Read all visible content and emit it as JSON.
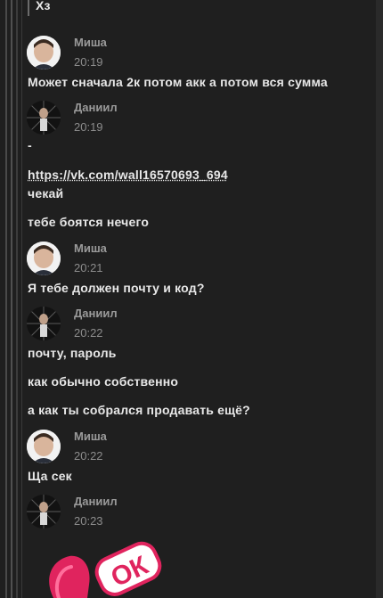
{
  "messages": {
    "quoted": "Хз",
    "m1": {
      "author": "Миша",
      "time": "20:19",
      "lines": [
        "Может сначала 2к потом акк а потом вся сумма"
      ]
    },
    "m2": {
      "author": "Даниил",
      "time": "20:19",
      "lines": [
        "-",
        "https://vk.com/wall16570693_694",
        "чекай",
        "тебе боятся нечего"
      ]
    },
    "m3": {
      "author": "Миша",
      "time": "20:21",
      "lines": [
        "Я тебе должен почту и код?"
      ]
    },
    "m4": {
      "author": "Даниил",
      "time": "20:22",
      "lines": [
        "почту, пароль",
        "как обычно собственно",
        "а как ты собрался продавать ещё?"
      ]
    },
    "m5": {
      "author": "Миша",
      "time": "20:22",
      "lines": [
        "Ща сек"
      ]
    },
    "m6": {
      "author": "Даниил",
      "time": "20:23"
    }
  },
  "sticker": {
    "text": "ОК",
    "color": "#e0245e"
  }
}
